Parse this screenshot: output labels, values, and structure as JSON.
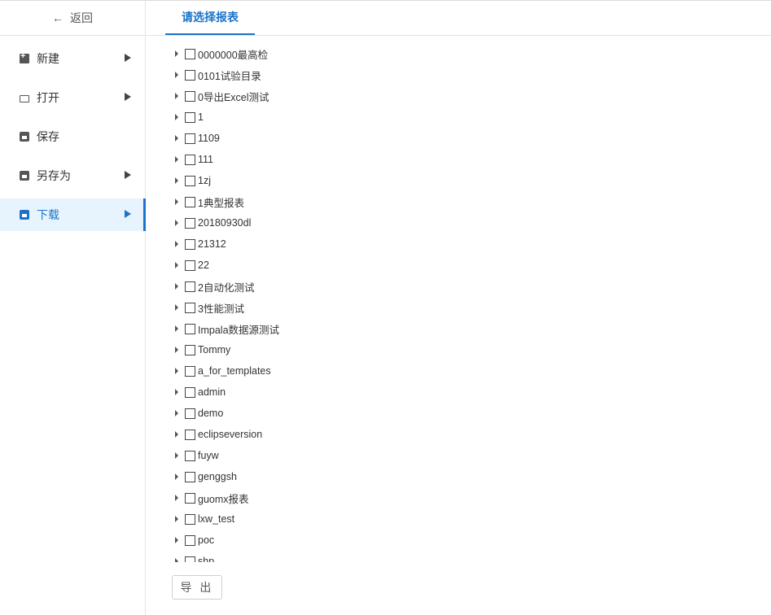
{
  "sidebar": {
    "back_label": "返回",
    "items": [
      {
        "label": "新建",
        "icon": "new-file-icon",
        "has_submenu": true,
        "active": false
      },
      {
        "label": "打开",
        "icon": "folder-icon",
        "has_submenu": true,
        "active": false
      },
      {
        "label": "保存",
        "icon": "save-icon",
        "has_submenu": false,
        "active": false
      },
      {
        "label": "另存为",
        "icon": "save-as-icon",
        "has_submenu": true,
        "active": false
      },
      {
        "label": "下载",
        "icon": "download-icon",
        "has_submenu": true,
        "active": true
      }
    ]
  },
  "main": {
    "tab_label": "请选择报表",
    "tree": [
      "0000000最高检",
      "0101试验目录",
      "0导出Excel测试",
      "1",
      "1109",
      "111",
      "1zj",
      "1典型报表",
      "20180930dl",
      "21312",
      "22",
      "2自动化测试",
      "3性能测试",
      "Impala数据源测试",
      "Tommy",
      "a_for_templates",
      "admin",
      "demo",
      "eclipseversion",
      "fuyw",
      "genggsh",
      "guomx报表",
      "lxw_test",
      "poc",
      "shp"
    ],
    "export_label": "导 出"
  },
  "colors": {
    "accent": "#1a73c9",
    "active_bg": "#e8f4fd"
  }
}
